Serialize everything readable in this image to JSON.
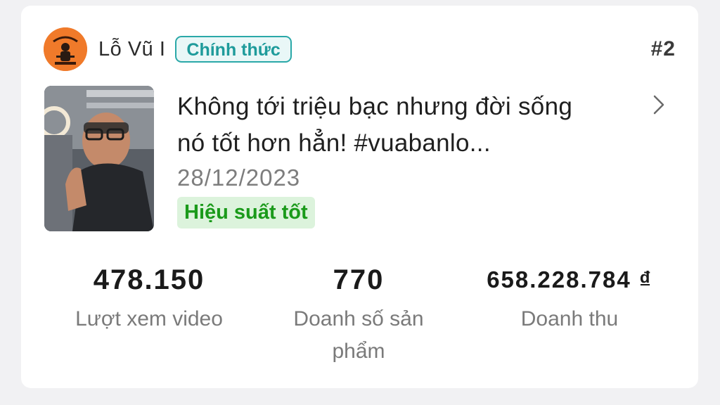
{
  "header": {
    "creator_name": "Lỗ Vũ I",
    "badge": "Chính thức",
    "rank": "#2"
  },
  "video": {
    "title_line1": "Không tới triệu bạc nhưng đời sống",
    "title_line2": "nó tốt hơn hẳn! #vuabanlo...",
    "date": "28/12/2023",
    "performance_tag": "Hiệu suất tốt"
  },
  "stats": [
    {
      "value": "478.150",
      "label": "Lượt xem video"
    },
    {
      "value": "770",
      "label": "Doanh số sản phẩm"
    },
    {
      "value": "658.228.784 ₫",
      "label": "Doanh thu"
    }
  ],
  "colors": {
    "badge_accent": "#2aa8a8",
    "performance_green": "#1a9a1a",
    "avatar_orange": "#f07a2a"
  }
}
